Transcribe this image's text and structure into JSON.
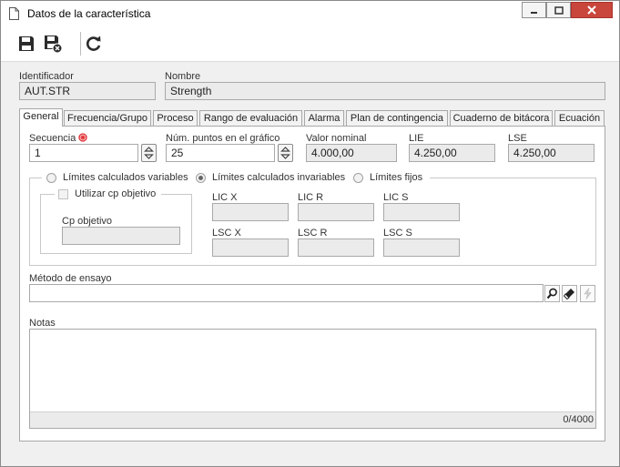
{
  "window": {
    "title": "Datos de la característica",
    "title_icon": "document-icon",
    "controls": [
      "minimize-icon",
      "maximize-icon",
      "close-icon"
    ]
  },
  "toolbar": {
    "buttons": [
      {
        "icon": "save-icon",
        "tooltip": ""
      },
      {
        "icon": "save-and-close-icon",
        "tooltip": ""
      },
      {
        "icon": "refresh-icon",
        "tooltip": ""
      }
    ]
  },
  "header": {
    "id_label": "Identificador",
    "id_value": "AUT.STR",
    "name_label": "Nombre",
    "name_value": "Strength"
  },
  "tabs": [
    {
      "label": "General",
      "active": true
    },
    {
      "label": "Frecuencia/Grupo",
      "active": false
    },
    {
      "label": "Proceso",
      "active": false
    },
    {
      "label": "Rango de evaluación",
      "active": false
    },
    {
      "label": "Alarma",
      "active": false
    },
    {
      "label": "Plan de contingencia",
      "active": false
    },
    {
      "label": "Cuaderno de bitácora",
      "active": false
    },
    {
      "label": "Ecuación",
      "active": false
    }
  ],
  "general": {
    "sequence_label": "Secuencia",
    "sequence_value": "1",
    "points_label": "Núm. puntos en el gráfico",
    "points_value": "25",
    "nominal_label": "Valor nominal",
    "nominal_value": "4.000,00",
    "lie_label": "LIE",
    "lie_value": "4.250,00",
    "lse_label": "LSE",
    "lse_value": "4.250,00",
    "limit_options": [
      "Límites calculados variables",
      "Límites calculados invariables",
      "Límites fijos"
    ],
    "selected_limit": "Límites calculados invariables",
    "use_cp_label": "Utilizar cp objetivo",
    "cp_label": "Cp objetivo",
    "cp_value": "",
    "lic_x_label": "LIC X",
    "lic_r_label": "LIC R",
    "lic_s_label": "LIC S",
    "lsc_x_label": "LSC X",
    "lsc_r_label": "LSC R",
    "lsc_s_label": "LSC S",
    "method_label": "Método de ensayo",
    "method_value": "",
    "notes_label": "Notas",
    "notes_value": "",
    "notes_counter": "0/4000"
  },
  "colors": {
    "required_marker": "#e0262a",
    "close_button": "#c9463d",
    "field_disabled": "#ebebeb"
  }
}
